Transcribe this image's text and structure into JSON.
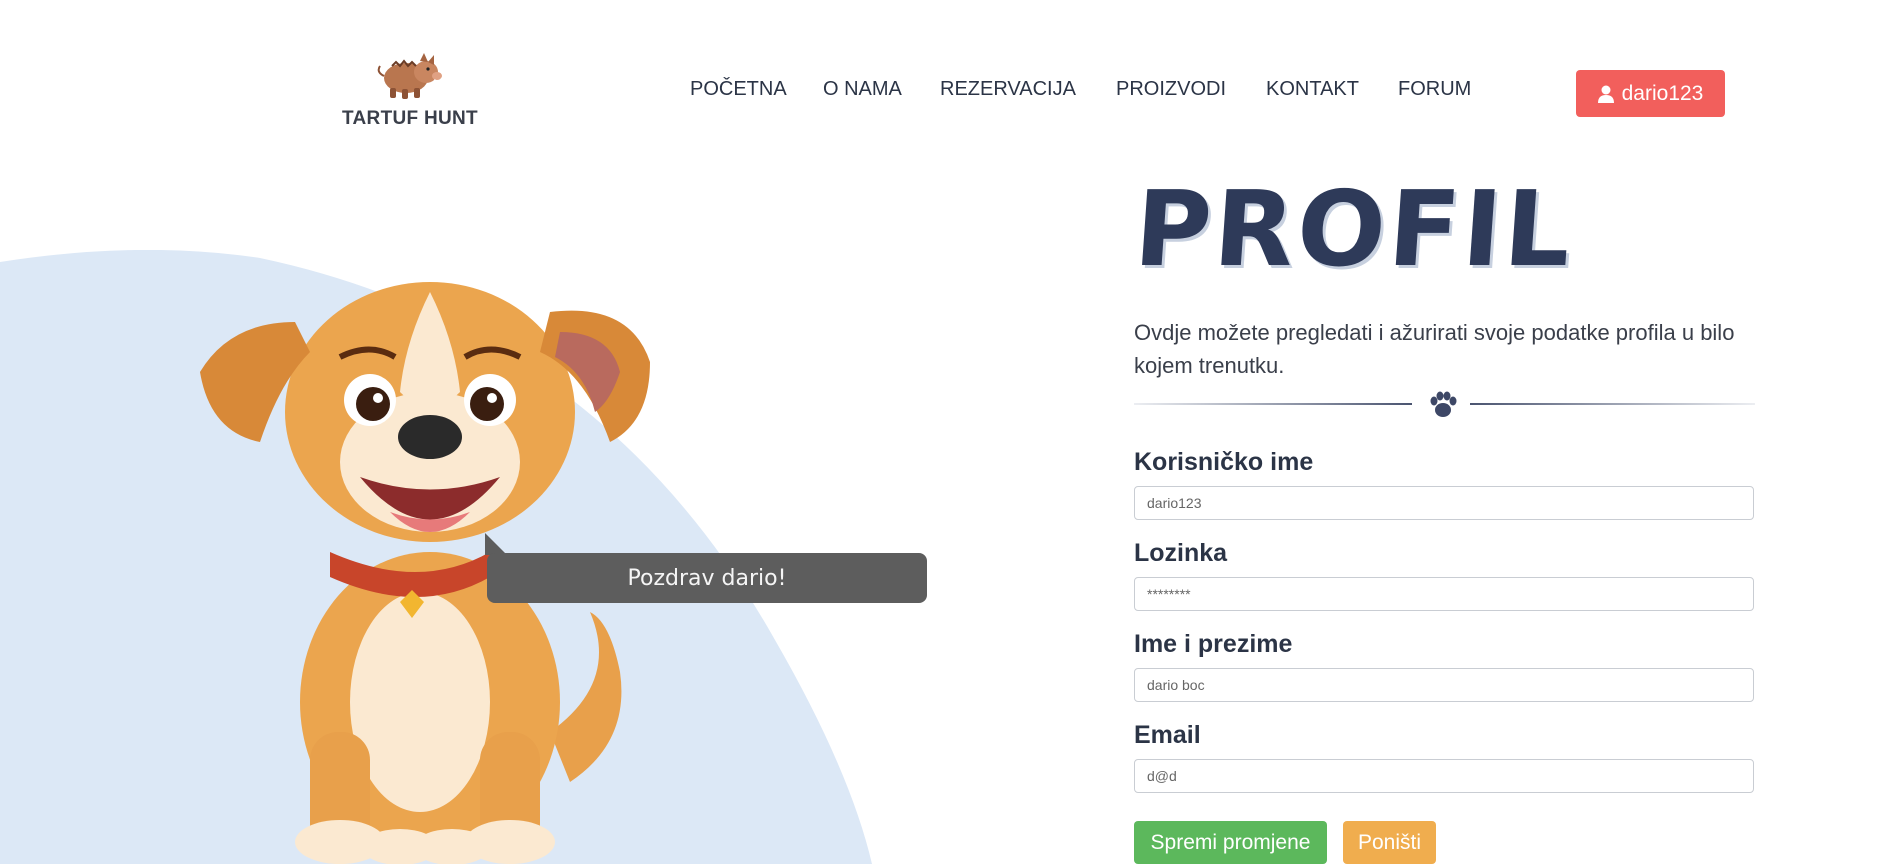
{
  "brand": {
    "name": "TARTUF HUNT",
    "logo_icon": "boar-icon"
  },
  "nav": [
    {
      "label": "POČETNA"
    },
    {
      "label": "O NAMA"
    },
    {
      "label": "REZERVACIJA"
    },
    {
      "label": "PROIZVODI"
    },
    {
      "label": "KONTAKT"
    },
    {
      "label": "FORUM"
    }
  ],
  "user": {
    "username": "dario123",
    "icon": "user-icon",
    "color": "#f25f5c"
  },
  "greeting": {
    "text": "Pozdrav dario!"
  },
  "profile": {
    "title": "PROFIL",
    "intro": "Ovdje možete pregledati i ažurirati svoje podatke profila u bilo kojem trenutku.",
    "divider_icon": "paw-icon",
    "fields": {
      "username": {
        "label": "Korisničko ime",
        "value": "dario123"
      },
      "password": {
        "label": "Lozinka",
        "value": "********"
      },
      "fullname": {
        "label": "Ime i prezime",
        "value": "dario boc"
      },
      "email": {
        "label": "Email",
        "value": "d@d"
      }
    },
    "buttons": {
      "save": {
        "label": "Spremi promjene",
        "color": "#5cb85c"
      },
      "cancel": {
        "label": "Poništi",
        "color": "#f0ad4e"
      }
    }
  },
  "colors": {
    "title": "#2e3a59",
    "blob": "#dce8f6"
  }
}
